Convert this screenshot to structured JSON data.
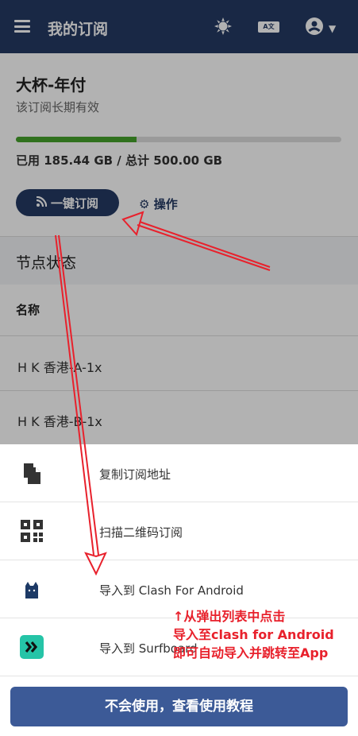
{
  "header": {
    "title": "我的订阅",
    "lang_label": "A文"
  },
  "plan": {
    "name": "大杯-年付",
    "validity": "该订阅长期有效",
    "usage_text": "已用 185.44 GB / 总计 500.00 GB",
    "usage_fraction": 0.37,
    "subscribe_button": "一键订阅",
    "operations_button": "操作"
  },
  "nodes": {
    "title": "节点状态",
    "column_name": "名称",
    "rows": [
      "H K 香港-A-1x",
      "H K 香港-B-1x"
    ]
  },
  "sheet": {
    "items": [
      {
        "label": "复制订阅地址",
        "icon": "copy-icon"
      },
      {
        "label": "扫描二维码订阅",
        "icon": "qrcode-icon"
      },
      {
        "label": "导入到 Clash For Android",
        "icon": "clash-cat-icon"
      },
      {
        "label": "导入到 Surfboard",
        "icon": "surfboard-icon"
      }
    ],
    "help_button": "不会使用，查看使用教程"
  },
  "annotation": {
    "line1": "↑从弹出列表中点击",
    "line2": "导入至clash for Android",
    "line3": "即可自动导入并跳转至App"
  },
  "colors": {
    "navbar": "#253a63",
    "primary_button": "#3c5a97",
    "progress": "#46a32c",
    "annotation": "#e8212c"
  }
}
